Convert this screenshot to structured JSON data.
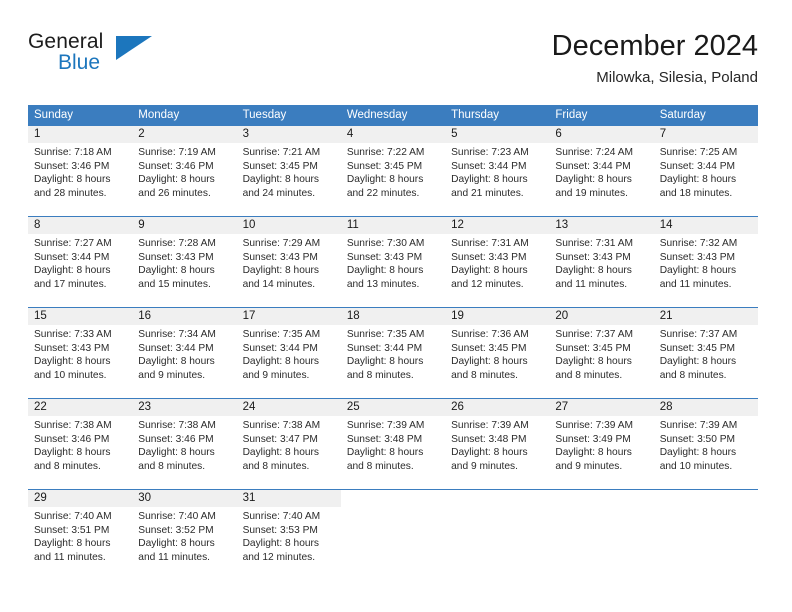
{
  "brand": {
    "name_part1": "General",
    "name_part2": "Blue",
    "accent_color": "#1c76bd"
  },
  "header": {
    "title": "December 2024",
    "location": "Milowka, Silesia, Poland"
  },
  "calendar": {
    "header_color": "#3b7dbf",
    "daynum_band_color": "#f0f0f0",
    "weekday_names": [
      "Sunday",
      "Monday",
      "Tuesday",
      "Wednesday",
      "Thursday",
      "Friday",
      "Saturday"
    ],
    "weeks": [
      [
        {
          "day": "1",
          "sunrise": "Sunrise: 7:18 AM",
          "sunset": "Sunset: 3:46 PM",
          "daylight1": "Daylight: 8 hours",
          "daylight2": "and 28 minutes."
        },
        {
          "day": "2",
          "sunrise": "Sunrise: 7:19 AM",
          "sunset": "Sunset: 3:46 PM",
          "daylight1": "Daylight: 8 hours",
          "daylight2": "and 26 minutes."
        },
        {
          "day": "3",
          "sunrise": "Sunrise: 7:21 AM",
          "sunset": "Sunset: 3:45 PM",
          "daylight1": "Daylight: 8 hours",
          "daylight2": "and 24 minutes."
        },
        {
          "day": "4",
          "sunrise": "Sunrise: 7:22 AM",
          "sunset": "Sunset: 3:45 PM",
          "daylight1": "Daylight: 8 hours",
          "daylight2": "and 22 minutes."
        },
        {
          "day": "5",
          "sunrise": "Sunrise: 7:23 AM",
          "sunset": "Sunset: 3:44 PM",
          "daylight1": "Daylight: 8 hours",
          "daylight2": "and 21 minutes."
        },
        {
          "day": "6",
          "sunrise": "Sunrise: 7:24 AM",
          "sunset": "Sunset: 3:44 PM",
          "daylight1": "Daylight: 8 hours",
          "daylight2": "and 19 minutes."
        },
        {
          "day": "7",
          "sunrise": "Sunrise: 7:25 AM",
          "sunset": "Sunset: 3:44 PM",
          "daylight1": "Daylight: 8 hours",
          "daylight2": "and 18 minutes."
        }
      ],
      [
        {
          "day": "8",
          "sunrise": "Sunrise: 7:27 AM",
          "sunset": "Sunset: 3:44 PM",
          "daylight1": "Daylight: 8 hours",
          "daylight2": "and 17 minutes."
        },
        {
          "day": "9",
          "sunrise": "Sunrise: 7:28 AM",
          "sunset": "Sunset: 3:43 PM",
          "daylight1": "Daylight: 8 hours",
          "daylight2": "and 15 minutes."
        },
        {
          "day": "10",
          "sunrise": "Sunrise: 7:29 AM",
          "sunset": "Sunset: 3:43 PM",
          "daylight1": "Daylight: 8 hours",
          "daylight2": "and 14 minutes."
        },
        {
          "day": "11",
          "sunrise": "Sunrise: 7:30 AM",
          "sunset": "Sunset: 3:43 PM",
          "daylight1": "Daylight: 8 hours",
          "daylight2": "and 13 minutes."
        },
        {
          "day": "12",
          "sunrise": "Sunrise: 7:31 AM",
          "sunset": "Sunset: 3:43 PM",
          "daylight1": "Daylight: 8 hours",
          "daylight2": "and 12 minutes."
        },
        {
          "day": "13",
          "sunrise": "Sunrise: 7:31 AM",
          "sunset": "Sunset: 3:43 PM",
          "daylight1": "Daylight: 8 hours",
          "daylight2": "and 11 minutes."
        },
        {
          "day": "14",
          "sunrise": "Sunrise: 7:32 AM",
          "sunset": "Sunset: 3:43 PM",
          "daylight1": "Daylight: 8 hours",
          "daylight2": "and 11 minutes."
        }
      ],
      [
        {
          "day": "15",
          "sunrise": "Sunrise: 7:33 AM",
          "sunset": "Sunset: 3:43 PM",
          "daylight1": "Daylight: 8 hours",
          "daylight2": "and 10 minutes."
        },
        {
          "day": "16",
          "sunrise": "Sunrise: 7:34 AM",
          "sunset": "Sunset: 3:44 PM",
          "daylight1": "Daylight: 8 hours",
          "daylight2": "and 9 minutes."
        },
        {
          "day": "17",
          "sunrise": "Sunrise: 7:35 AM",
          "sunset": "Sunset: 3:44 PM",
          "daylight1": "Daylight: 8 hours",
          "daylight2": "and 9 minutes."
        },
        {
          "day": "18",
          "sunrise": "Sunrise: 7:35 AM",
          "sunset": "Sunset: 3:44 PM",
          "daylight1": "Daylight: 8 hours",
          "daylight2": "and 8 minutes."
        },
        {
          "day": "19",
          "sunrise": "Sunrise: 7:36 AM",
          "sunset": "Sunset: 3:45 PM",
          "daylight1": "Daylight: 8 hours",
          "daylight2": "and 8 minutes."
        },
        {
          "day": "20",
          "sunrise": "Sunrise: 7:37 AM",
          "sunset": "Sunset: 3:45 PM",
          "daylight1": "Daylight: 8 hours",
          "daylight2": "and 8 minutes."
        },
        {
          "day": "21",
          "sunrise": "Sunrise: 7:37 AM",
          "sunset": "Sunset: 3:45 PM",
          "daylight1": "Daylight: 8 hours",
          "daylight2": "and 8 minutes."
        }
      ],
      [
        {
          "day": "22",
          "sunrise": "Sunrise: 7:38 AM",
          "sunset": "Sunset: 3:46 PM",
          "daylight1": "Daylight: 8 hours",
          "daylight2": "and 8 minutes."
        },
        {
          "day": "23",
          "sunrise": "Sunrise: 7:38 AM",
          "sunset": "Sunset: 3:46 PM",
          "daylight1": "Daylight: 8 hours",
          "daylight2": "and 8 minutes."
        },
        {
          "day": "24",
          "sunrise": "Sunrise: 7:38 AM",
          "sunset": "Sunset: 3:47 PM",
          "daylight1": "Daylight: 8 hours",
          "daylight2": "and 8 minutes."
        },
        {
          "day": "25",
          "sunrise": "Sunrise: 7:39 AM",
          "sunset": "Sunset: 3:48 PM",
          "daylight1": "Daylight: 8 hours",
          "daylight2": "and 8 minutes."
        },
        {
          "day": "26",
          "sunrise": "Sunrise: 7:39 AM",
          "sunset": "Sunset: 3:48 PM",
          "daylight1": "Daylight: 8 hours",
          "daylight2": "and 9 minutes."
        },
        {
          "day": "27",
          "sunrise": "Sunrise: 7:39 AM",
          "sunset": "Sunset: 3:49 PM",
          "daylight1": "Daylight: 8 hours",
          "daylight2": "and 9 minutes."
        },
        {
          "day": "28",
          "sunrise": "Sunrise: 7:39 AM",
          "sunset": "Sunset: 3:50 PM",
          "daylight1": "Daylight: 8 hours",
          "daylight2": "and 10 minutes."
        }
      ],
      [
        {
          "day": "29",
          "sunrise": "Sunrise: 7:40 AM",
          "sunset": "Sunset: 3:51 PM",
          "daylight1": "Daylight: 8 hours",
          "daylight2": "and 11 minutes."
        },
        {
          "day": "30",
          "sunrise": "Sunrise: 7:40 AM",
          "sunset": "Sunset: 3:52 PM",
          "daylight1": "Daylight: 8 hours",
          "daylight2": "and 11 minutes."
        },
        {
          "day": "31",
          "sunrise": "Sunrise: 7:40 AM",
          "sunset": "Sunset: 3:53 PM",
          "daylight1": "Daylight: 8 hours",
          "daylight2": "and 12 minutes."
        },
        {
          "day": "",
          "sunrise": "",
          "sunset": "",
          "daylight1": "",
          "daylight2": ""
        },
        {
          "day": "",
          "sunrise": "",
          "sunset": "",
          "daylight1": "",
          "daylight2": ""
        },
        {
          "day": "",
          "sunrise": "",
          "sunset": "",
          "daylight1": "",
          "daylight2": ""
        },
        {
          "day": "",
          "sunrise": "",
          "sunset": "",
          "daylight1": "",
          "daylight2": ""
        }
      ]
    ]
  }
}
